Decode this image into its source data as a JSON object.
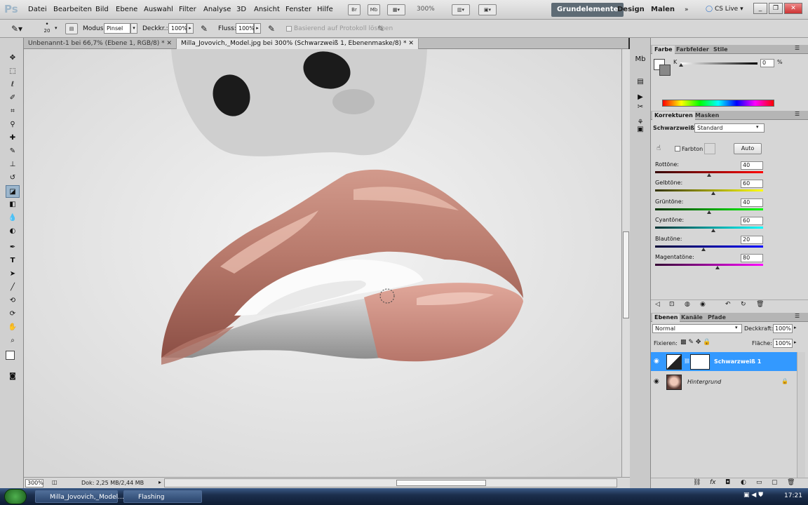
{
  "app": {
    "logo": "Ps"
  },
  "menu": [
    "Datei",
    "Bearbeiten",
    "Bild",
    "Ebene",
    "Auswahl",
    "Filter",
    "Analyse",
    "3D",
    "Ansicht",
    "Fenster",
    "Hilfe"
  ],
  "menubar_tools": {
    "zoom": "300%"
  },
  "workspaces": {
    "active": "Grundelemente",
    "design": "Design",
    "malen": "Malen",
    "cs_live": "CS Live"
  },
  "options": {
    "brush_size": "20",
    "modus_label": "Modus:",
    "modus_value": "Pinsel",
    "deckkr_label": "Deckkr.:",
    "deckkr_value": "100%",
    "fluss_label": "Fluss:",
    "fluss_value": "100%",
    "history_label": "Basierend auf Protokoll löschen"
  },
  "tabs": [
    {
      "label": "Unbenannt-1 bei 66,7% (Ebene 1, RGB/8) *"
    },
    {
      "label": "Milla_Jovovich,_Model.jpg bei 300% (Schwarzweiß 1, Ebenenmaske/8) *"
    }
  ],
  "status": {
    "zoom": "300%",
    "doc": "Dok: 2,25 MB/2,44 MB"
  },
  "color_panel": {
    "tabs": [
      "Farbe",
      "Farbfelder",
      "Stile"
    ],
    "channel": "K",
    "value": "0",
    "unit": "%"
  },
  "adjust_panel": {
    "tabs": [
      "Korrekturen",
      "Masken"
    ],
    "title": "Schwarzweiß",
    "preset": "Standard",
    "tint_label": "Farbton",
    "auto_label": "Auto",
    "sliders": [
      {
        "label": "Rottöne:",
        "value": "40",
        "level": 0.5
      },
      {
        "label": "Gelbtöne:",
        "value": "60",
        "level": 0.54
      },
      {
        "label": "Grüntöne:",
        "value": "40",
        "level": 0.5
      },
      {
        "label": "Cyantöne:",
        "value": "60",
        "level": 0.54
      },
      {
        "label": "Blautöne:",
        "value": "20",
        "level": 0.45
      },
      {
        "label": "Magentatöne:",
        "value": "80",
        "level": 0.58
      }
    ]
  },
  "layers_panel": {
    "tabs": [
      "Ebenen",
      "Kanäle",
      "Pfade"
    ],
    "blend": "Normal",
    "opacity_label": "Deckkraft:",
    "opacity": "100%",
    "lock_label": "Fixieren:",
    "fill_label": "Fläche:",
    "fill": "100%",
    "layers": [
      {
        "name": "Schwarzweiß 1",
        "selected": true
      },
      {
        "name": "Hintergrund",
        "selected": false
      }
    ]
  },
  "taskbar": {
    "items": [
      "Milla_Jovovich,_Model...",
      "Flashing"
    ],
    "time": "17:21"
  },
  "colors": {
    "accent": "#3399ff",
    "ws_active": "#5e6b75",
    "lip": "#b8766a"
  }
}
